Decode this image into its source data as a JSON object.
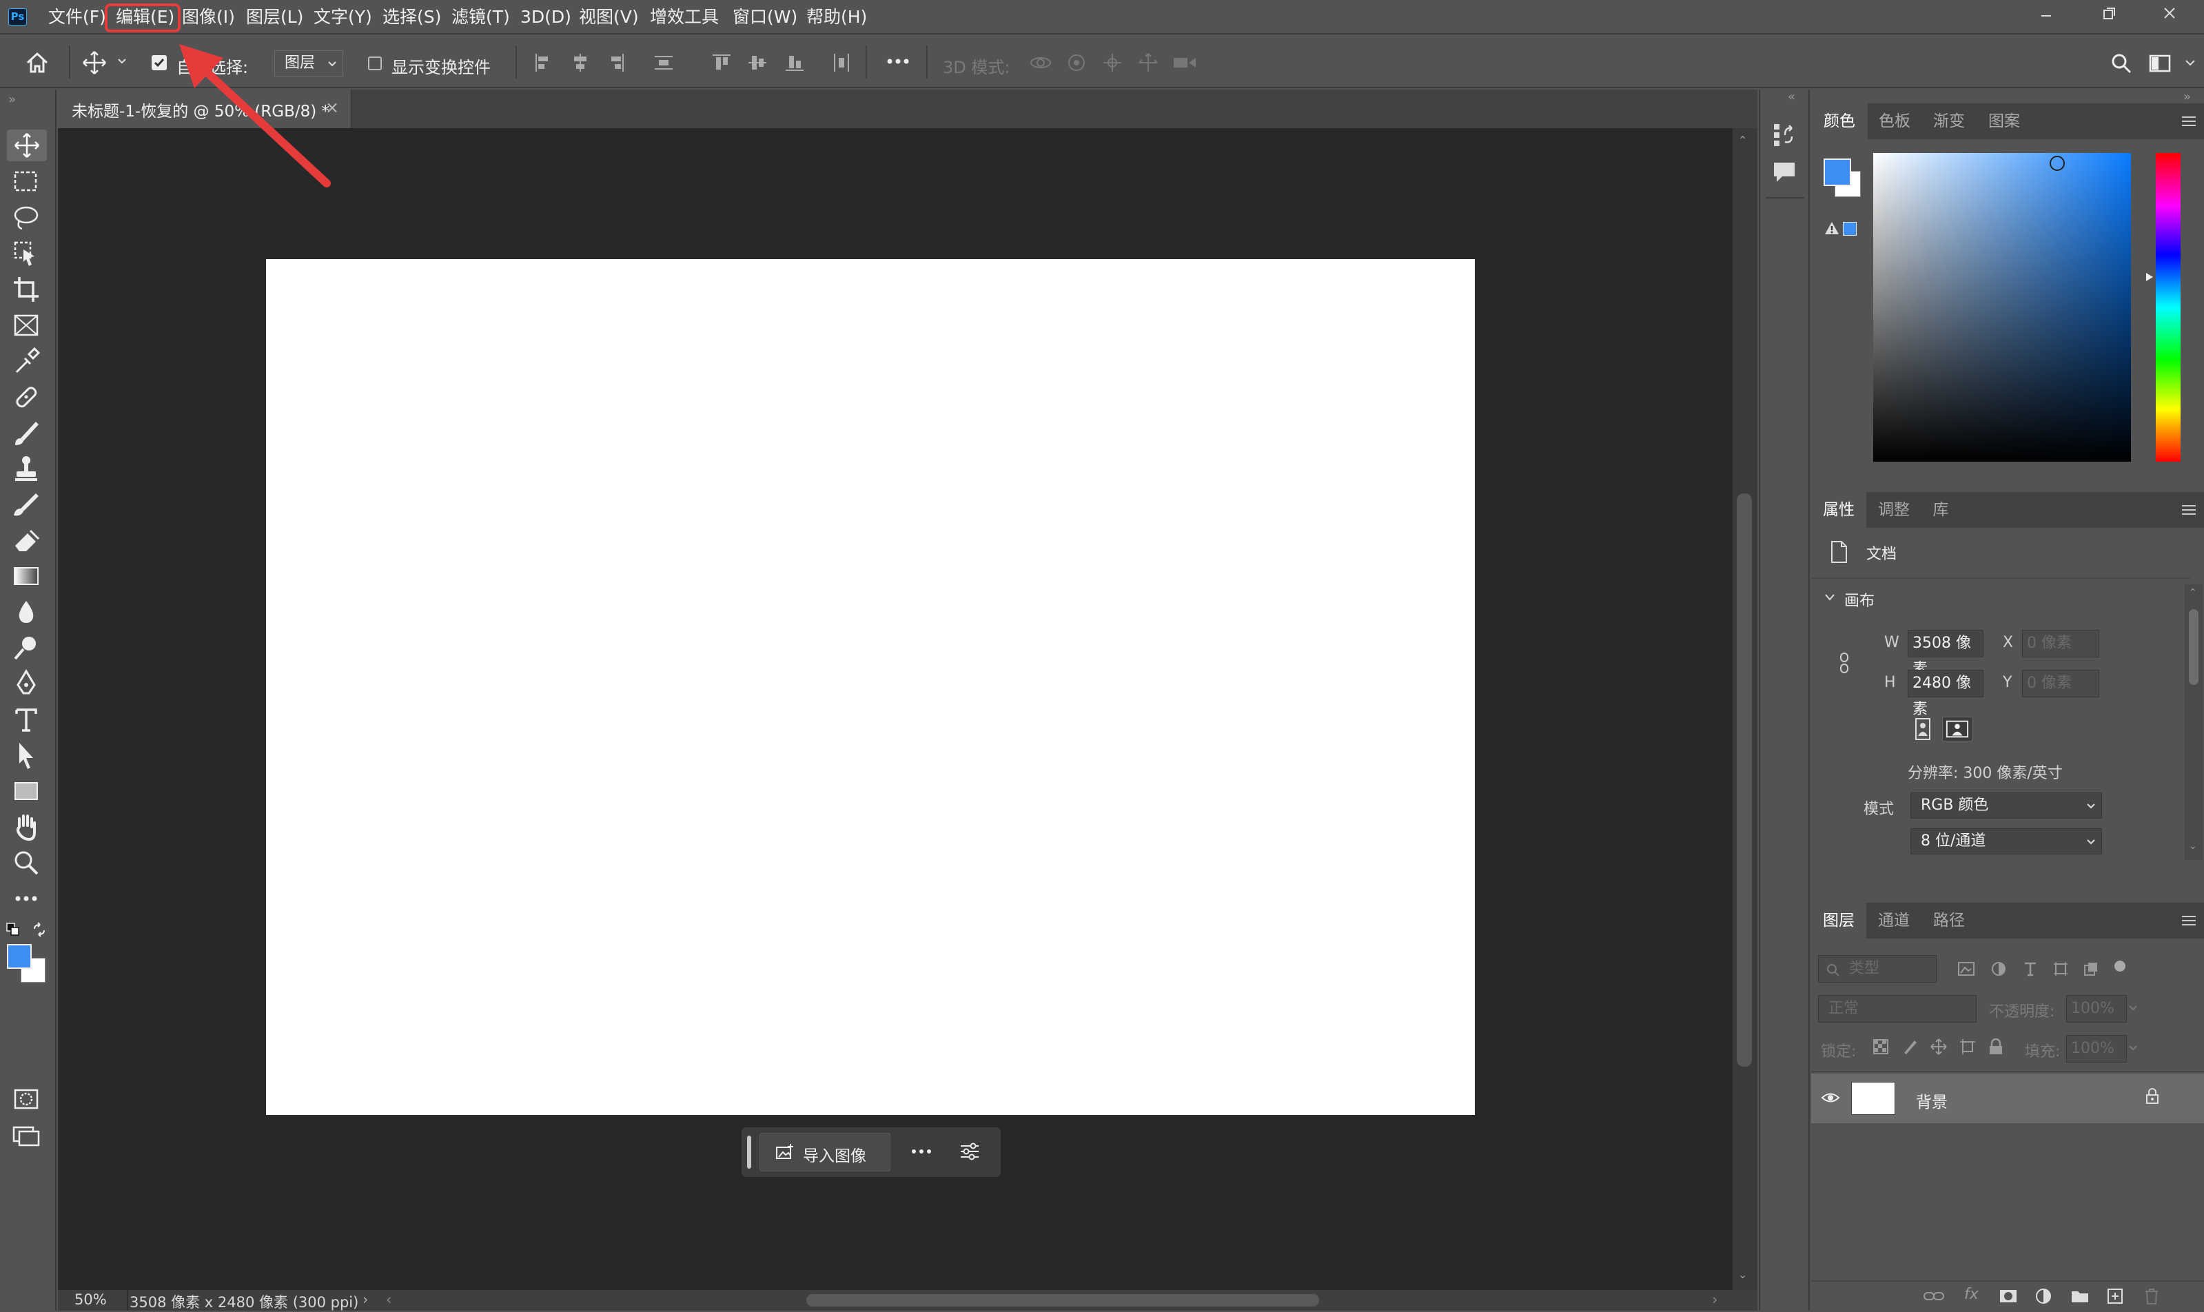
{
  "app": {
    "logo": "Ps"
  },
  "menu": [
    "文件(F)",
    "编辑(E)",
    "图像(I)",
    "图层(L)",
    "文字(Y)",
    "选择(S)",
    "滤镜(T)",
    "3D(D)",
    "视图(V)",
    "增效工具",
    "窗口(W)",
    "帮助(H)"
  ],
  "options": {
    "auto_select_label": "自动选择:",
    "layer_select_value": "图层",
    "show_transform_label": "显示变换控件",
    "mode_3d_label": "3D 模式:"
  },
  "document": {
    "tab_title": "未标题-1-恢复的 @ 50% (RGB/8) *",
    "close": "×"
  },
  "contextual_bar": {
    "import_label": "导入图像"
  },
  "status": {
    "zoom": "50%",
    "info": "3508 像素 x 2480 像素 (300 ppi)"
  },
  "color_panel": {
    "tabs": [
      "颜色",
      "色板",
      "渐变",
      "图案"
    ],
    "foreground": "#3d8ef0",
    "background": "#ffffff"
  },
  "properties_panel": {
    "tabs": [
      "属性",
      "调整",
      "库"
    ],
    "doc_label": "文档",
    "canvas_section": "画布",
    "w_label": "W",
    "w_value": "3508 像素",
    "h_label": "H",
    "h_value": "2480 像素",
    "x_label": "X",
    "x_placeholder": "0 像素",
    "y_label": "Y",
    "y_placeholder": "0 像素",
    "resolution": "分辨率: 300 像素/英寸",
    "mode_label": "模式",
    "mode_value": "RGB 颜色",
    "depth_value": "8 位/通道"
  },
  "layers_panel": {
    "tabs": [
      "图层",
      "通道",
      "路径"
    ],
    "filter_placeholder": "类型",
    "blend_mode": "正常",
    "opacity_label": "不透明度:",
    "opacity_value": "100%",
    "lock_label": "锁定:",
    "fill_label": "填充:",
    "fill_value": "100%",
    "layers": [
      {
        "name": "背景"
      }
    ]
  },
  "colors": {
    "highlight_red": "#e63b3b",
    "canvas_bg": "#282828",
    "ui_bg": "#535353"
  }
}
